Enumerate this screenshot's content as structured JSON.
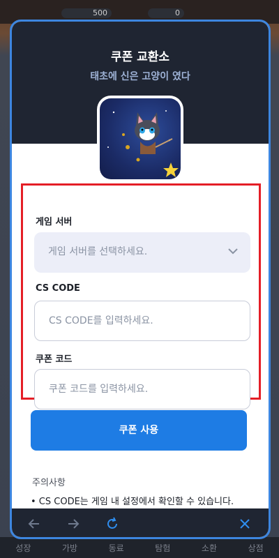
{
  "background": {
    "top_value_1": "500",
    "top_value_2": "0",
    "bottom_tabs": [
      "성장",
      "가방",
      "동료",
      "탐험",
      "소환",
      "상점"
    ]
  },
  "modal": {
    "title": "쿠폰 교환소",
    "subtitle": "태초에 신은 고양이 였다",
    "icon_name": "game-app-icon"
  },
  "form": {
    "server": {
      "label": "게임 서버",
      "placeholder": "게임 서버를 선택하세요."
    },
    "cs_code": {
      "label": "CS CODE",
      "placeholder": "CS CODE를 입력하세요."
    },
    "coupon": {
      "label": "쿠폰 코드",
      "placeholder": "쿠폰 코드를 입력하세요."
    },
    "submit_label": "쿠폰 사용"
  },
  "notes": {
    "title": "주의사항",
    "items": [
      "• CS CODE는 게임 내 설정에서 확인할 수 있습니다."
    ]
  },
  "nav": {
    "icons": [
      "arrow-left-icon",
      "arrow-right-icon",
      "refresh-icon",
      "close-icon"
    ]
  },
  "colors": {
    "accent": "#1e7ce4",
    "header": "#1f2532",
    "highlight": "#e41e26",
    "modal_border": "#3d86e0"
  }
}
